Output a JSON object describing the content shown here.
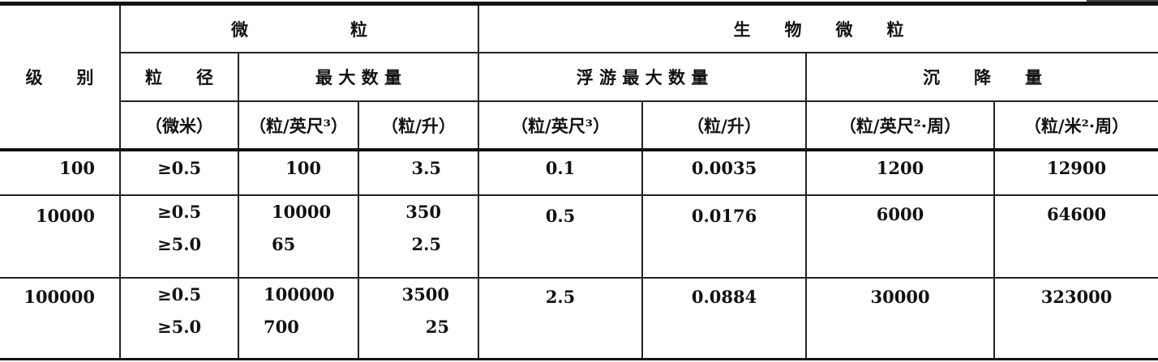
{
  "header": {
    "grade": "级　　别",
    "particle_group": "微　　　　　　粒",
    "bio_group": "生　　物　　微　　粒",
    "diameter": "粒　　径",
    "max_count": "最 大 数 量",
    "floating_max": "浮 游 最 大 数 量",
    "settling": "沉　　降　　量",
    "unit_micron": "（微米）",
    "unit_ft3": "（粒/英尺³）",
    "unit_l": "（粒/升）",
    "unit_bio_ft3": "（粒/英尺³）",
    "unit_bio_l": "（粒/升）",
    "unit_ft2_week": "（粒/英尺²·周）",
    "unit_m2_week": "（粒/米²·周）"
  },
  "rows": [
    {
      "grade": "100",
      "diameter": [
        "≥0.5"
      ],
      "ft3": [
        "100"
      ],
      "l": [
        "3.5"
      ],
      "bio_ft3": "0.1",
      "bio_l": "0.0035",
      "settle_ft2": "1200",
      "settle_m2": "12900"
    },
    {
      "grade": "10000",
      "diameter": [
        "≥0.5",
        "≥5.0"
      ],
      "ft3": [
        "10000",
        "65"
      ],
      "l": [
        "350",
        "2.5"
      ],
      "bio_ft3": "0.5",
      "bio_l": "0.0176",
      "settle_ft2": "6000",
      "settle_m2": "64600"
    },
    {
      "grade": "100000",
      "diameter": [
        "≥0.5",
        "≥5.0"
      ],
      "ft3": [
        "100000",
        "700"
      ],
      "l": [
        "3500",
        "25"
      ],
      "bio_ft3": "2.5",
      "bio_l": "0.0884",
      "settle_ft2": "30000",
      "settle_m2": "323000"
    }
  ]
}
